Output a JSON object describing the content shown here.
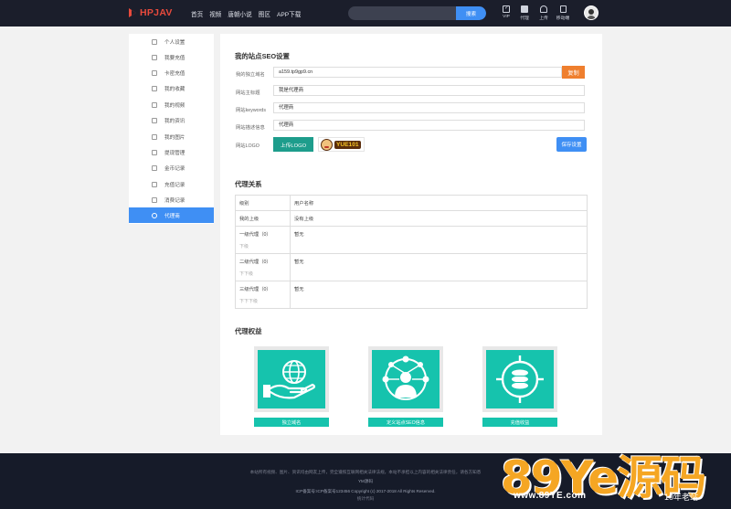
{
  "header": {
    "logo_text": "HPJAV",
    "nav": [
      "首页",
      "视频",
      "唐朝小说",
      "图区",
      "APP下载"
    ],
    "search": {
      "placeholder": "",
      "button": "搜索"
    },
    "tools": [
      "VIP",
      "代理",
      "上传",
      "移动端"
    ]
  },
  "sidebar": {
    "items": [
      {
        "label": "个人设置",
        "icon": "user-icon"
      },
      {
        "label": "我要充值",
        "icon": "wallet-icon"
      },
      {
        "label": "卡密充值",
        "icon": "card-icon"
      },
      {
        "label": "我的收藏",
        "icon": "star-icon"
      },
      {
        "label": "我的视频",
        "icon": "video-icon"
      },
      {
        "label": "我的资讯",
        "icon": "book-icon"
      },
      {
        "label": "我的图片",
        "icon": "image-icon"
      },
      {
        "label": "提现管理",
        "icon": "withdraw-icon"
      },
      {
        "label": "金币记录",
        "icon": "coin-icon"
      },
      {
        "label": "充值记录",
        "icon": "record-icon"
      },
      {
        "label": "消费记录",
        "icon": "bill-icon"
      },
      {
        "label": "代理商",
        "icon": "agent-icon",
        "active": true
      }
    ]
  },
  "seo": {
    "title": "我的站点SEO设置",
    "domain_label": "我的独立域名",
    "domain_value": "a159.tp9gp9.cn",
    "copy_button": "复制",
    "site_title_label": "网站主标题",
    "site_title_value": "我是代理商",
    "keywords_label": "网站keywords",
    "keywords_value": "代理商",
    "description_label": "网站描述信息",
    "description_value": "代理商",
    "logo_label": "网站LOGO",
    "upload_button": "上传LOGO",
    "logo_preview_text": "YUE101",
    "save_button": "保存设置"
  },
  "relation": {
    "title": "代理关系",
    "headers": [
      "级别",
      "用户名称"
    ],
    "rows": [
      {
        "level": "我的上级",
        "sub": "",
        "name": "没有上级"
      },
      {
        "level": "一级代理（0）",
        "sub": "下级",
        "name": "暂无"
      },
      {
        "level": "二级代理（0）",
        "sub": "下下级",
        "name": "暂无"
      },
      {
        "level": "三级代理（0）",
        "sub": "下下下级",
        "name": "暂无"
      }
    ]
  },
  "benefits": {
    "title": "代理权益",
    "items": [
      {
        "label": "独立域名",
        "icon": "globe-hand-icon"
      },
      {
        "label": "定义站点SEO信息",
        "icon": "network-user-icon"
      },
      {
        "label": "充值收益",
        "icon": "coin-target-icon"
      }
    ]
  },
  "footer": {
    "line1": "本站所有视频、图片、资讯均由网友上传，完全遵照互联网相关法律法规，本站不承担以上内容的相关法律责任，请各方知悉",
    "line2": "YM源码",
    "line3": "ICP备案号:ICP备案号123456   Copyright (c) 2017-2018 All Rights Reserved.",
    "line4": "统计代码"
  },
  "watermark": {
    "big": "89Ye源码",
    "url": "www.89YE.com",
    "badge": "10年老站"
  },
  "colors": {
    "nav_bg": "#1b1e2b",
    "brand": "#e84a3c",
    "primary": "#3f8ff4",
    "teal": "#16c3ad",
    "orange": "#ef7f2e",
    "watermark": "#f5a623"
  }
}
